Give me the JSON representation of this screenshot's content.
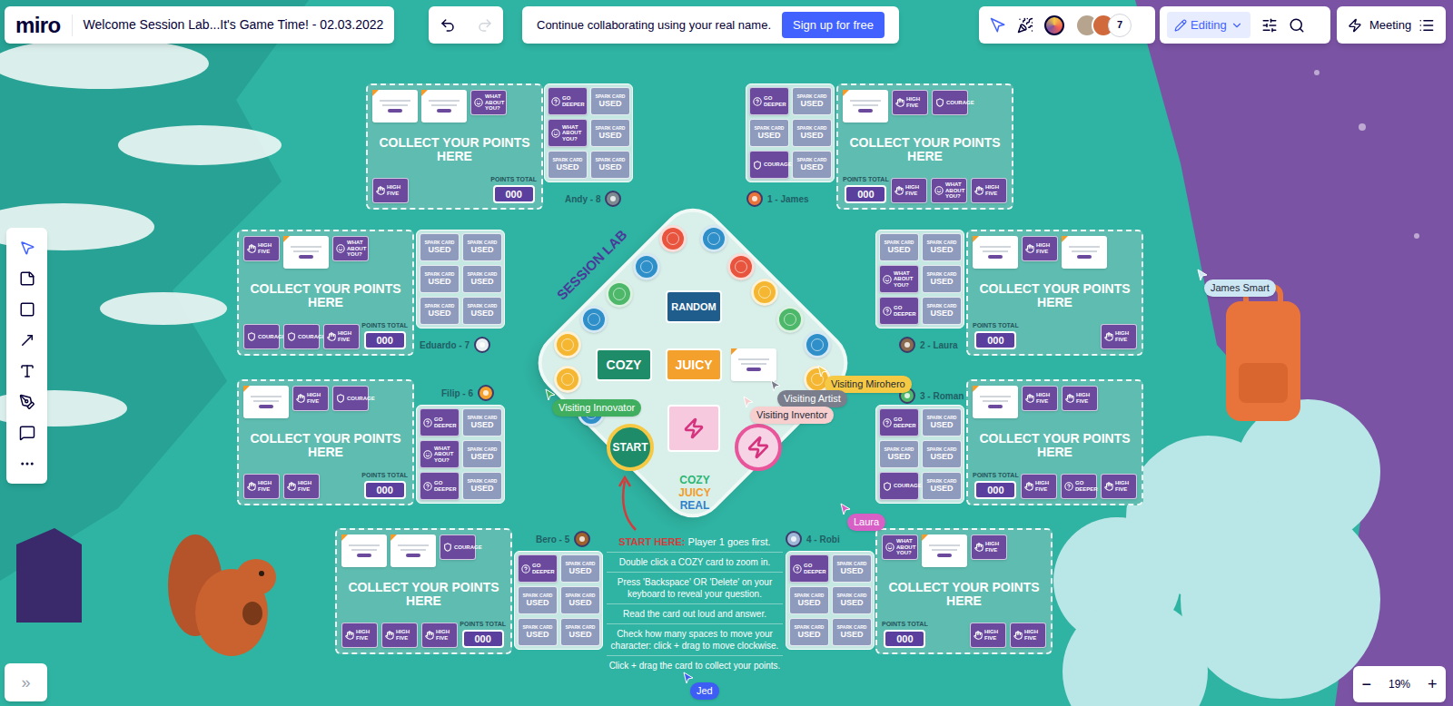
{
  "topbar": {
    "logo": "miro",
    "title": "Welcome Session Lab...It's Game Time! - 02.03.2022",
    "undo_enabled": true,
    "redo_enabled": false,
    "banner_text": "Continue collaborating using your real name.",
    "banner_button": "Sign up for free",
    "collaborators": "7",
    "mode": "Editing",
    "meeting": "Meeting"
  },
  "toolbar": [
    {
      "selected": true
    },
    {
      "selected": false
    },
    {
      "selected": false
    },
    {
      "selected": false
    },
    {
      "selected": false
    },
    {
      "selected": false
    },
    {
      "selected": false
    },
    {
      "selected": false
    }
  ],
  "expand": "»",
  "zoom": {
    "minus": "−",
    "level": "19%",
    "plus": "+"
  },
  "labels": {
    "spark_top": "SPARK CARD",
    "spark_main": "USED",
    "collect": "COLLECT YOUR POINTS HERE",
    "points_label": "POINTS TOTAL"
  },
  "card_types": [
    "GO DEEPER",
    "WHAT ABOUT YOU?",
    "COURAGE",
    "HIGH FIVE"
  ],
  "players": [
    {
      "label": "1 - James",
      "points": "000",
      "avatar": "#e8743b",
      "deck": [
        {
          "kind": "card",
          "type": 0
        },
        {
          "kind": "used"
        },
        {
          "kind": "used"
        },
        {
          "kind": "used"
        },
        {
          "kind": "card",
          "type": 2
        },
        {
          "kind": "used"
        }
      ],
      "collected": [
        {
          "kind": "note"
        },
        {
          "kind": "card",
          "type": 3
        },
        {
          "kind": "card",
          "type": 2
        },
        {
          "kind": "card",
          "type": 3
        },
        {
          "kind": "card",
          "type": 1
        },
        {
          "kind": "card",
          "type": 3
        }
      ]
    },
    {
      "label": "2 - Laura",
      "points": "000",
      "avatar": "#8a6a4f",
      "deck": [
        {
          "kind": "used"
        },
        {
          "kind": "used"
        },
        {
          "kind": "card",
          "type": 1
        },
        {
          "kind": "used"
        },
        {
          "kind": "card",
          "type": 0
        },
        {
          "kind": "used"
        }
      ],
      "collected": [
        {
          "kind": "note"
        },
        {
          "kind": "card",
          "type": 3
        },
        {
          "kind": "note"
        },
        {
          "kind": "card",
          "type": 3
        }
      ]
    },
    {
      "label": "3 - Roman",
      "points": "000",
      "avatar": "#4db86a",
      "deck": [
        {
          "kind": "card",
          "type": 0
        },
        {
          "kind": "used"
        },
        {
          "kind": "used"
        },
        {
          "kind": "used"
        },
        {
          "kind": "card",
          "type": 2
        },
        {
          "kind": "used"
        }
      ],
      "collected": [
        {
          "kind": "note"
        },
        {
          "kind": "card",
          "type": 3
        },
        {
          "kind": "card",
          "type": 3
        },
        {
          "kind": "card",
          "type": 3
        },
        {
          "kind": "card",
          "type": 0
        },
        {
          "kind": "card",
          "type": 3
        }
      ]
    },
    {
      "label": "4 - Robi",
      "points": "000",
      "avatar": "#9fb7d6",
      "deck": [
        {
          "kind": "card",
          "type": 0
        },
        {
          "kind": "used"
        },
        {
          "kind": "used"
        },
        {
          "kind": "used"
        },
        {
          "kind": "used"
        },
        {
          "kind": "used"
        }
      ],
      "collected": [
        {
          "kind": "card",
          "type": 1
        },
        {
          "kind": "note"
        },
        {
          "kind": "card",
          "type": 3
        },
        {
          "kind": "card",
          "type": 3
        },
        {
          "kind": "card",
          "type": 3
        }
      ]
    },
    {
      "label": "Bero - 5",
      "points": "000",
      "avatar": "#a0622d",
      "deck": [
        {
          "kind": "card",
          "type": 0
        },
        {
          "kind": "used"
        },
        {
          "kind": "used"
        },
        {
          "kind": "used"
        },
        {
          "kind": "used"
        },
        {
          "kind": "used"
        }
      ],
      "collected": [
        {
          "kind": "note"
        },
        {
          "kind": "note"
        },
        {
          "kind": "card",
          "type": 2
        },
        {
          "kind": "card",
          "type": 3
        },
        {
          "kind": "card",
          "type": 3
        },
        {
          "kind": "card",
          "type": 3
        }
      ]
    },
    {
      "label": "Filip - 6",
      "points": "000",
      "avatar": "#f3a02c",
      "deck": [
        {
          "kind": "card",
          "type": 0
        },
        {
          "kind": "used"
        },
        {
          "kind": "card",
          "type": 1
        },
        {
          "kind": "used"
        },
        {
          "kind": "card",
          "type": 0
        },
        {
          "kind": "used"
        }
      ],
      "collected": [
        {
          "kind": "note"
        },
        {
          "kind": "card",
          "type": 3
        },
        {
          "kind": "card",
          "type": 2
        },
        {
          "kind": "card",
          "type": 3
        },
        {
          "kind": "card",
          "type": 3
        }
      ]
    },
    {
      "label": "Eduardo - 7",
      "points": "000",
      "avatar": "#e9eef0",
      "deck": [
        {
          "kind": "used"
        },
        {
          "kind": "used"
        },
        {
          "kind": "used"
        },
        {
          "kind": "used"
        },
        {
          "kind": "used"
        },
        {
          "kind": "used"
        }
      ],
      "collected": [
        {
          "kind": "card",
          "type": 3
        },
        {
          "kind": "note"
        },
        {
          "kind": "card",
          "type": 1
        },
        {
          "kind": "card",
          "type": 2
        },
        {
          "kind": "card",
          "type": 2
        },
        {
          "kind": "card",
          "type": 3
        }
      ]
    },
    {
      "label": "Andy - 8",
      "points": "000",
      "avatar": "#7d8a90",
      "deck": [
        {
          "kind": "card",
          "type": 0
        },
        {
          "kind": "used"
        },
        {
          "kind": "card",
          "type": 1
        },
        {
          "kind": "used"
        },
        {
          "kind": "used"
        },
        {
          "kind": "used"
        }
      ],
      "collected": [
        {
          "kind": "note"
        },
        {
          "kind": "note"
        },
        {
          "kind": "card",
          "type": 1
        },
        {
          "kind": "card",
          "type": 3
        }
      ]
    }
  ],
  "board": {
    "title": "SESSION LAB",
    "random": "RANDOM",
    "cozy": "COZY",
    "juicy": "JUICY",
    "start": "START",
    "tagline": [
      {
        "text": "COZY",
        "color": "#2bb673"
      },
      {
        "text": "JUICY",
        "color": "#f39c2a"
      },
      {
        "text": "REAL",
        "color": "#2f7fc9"
      }
    ],
    "spaces": [
      {
        "color": "#2f8fc9"
      },
      {
        "color": "#f5b731"
      },
      {
        "color": "#f5b731"
      },
      {
        "color": "#2f8fc9"
      },
      {
        "color": "#4db86a"
      },
      {
        "color": "#2f8fc9"
      },
      {
        "color": "#e8543e"
      },
      {
        "color": "#2f8fc9"
      },
      {
        "color": "#e8543e"
      },
      {
        "color": "#f5b731"
      },
      {
        "color": "#4db86a"
      },
      {
        "color": "#2f8fc9"
      },
      {
        "color": "#f5b731"
      },
      {
        "color": "#e8543e"
      }
    ]
  },
  "instructions": {
    "start_label": "START HERE:",
    "start_text": " Player 1 goes first.",
    "steps": [
      "Double click a COZY card to zoom in.",
      "Press 'Backspace' OR 'Delete' on your keyboard to reveal your question.",
      "Read the card out loud and answer.",
      "Check how many spaces to move your character: click + drag to move clockwise.",
      "Click + drag the card to collect your points."
    ]
  },
  "cursors": [
    {
      "name": "James Smart",
      "color": "#cde6f3"
    },
    {
      "name": "Laura",
      "color": "#d85fc6"
    },
    {
      "name": "Jed",
      "color": "#3d5df5"
    },
    {
      "name": "Visiting Mirohero",
      "color": "#f6c944"
    },
    {
      "name": "Visiting Artist",
      "color": "#7a7e8c"
    },
    {
      "name": "Visiting Inventor",
      "color": "#f7cfcf"
    },
    {
      "name": "Visiting Innovator",
      "color": "#3fae5e"
    }
  ]
}
